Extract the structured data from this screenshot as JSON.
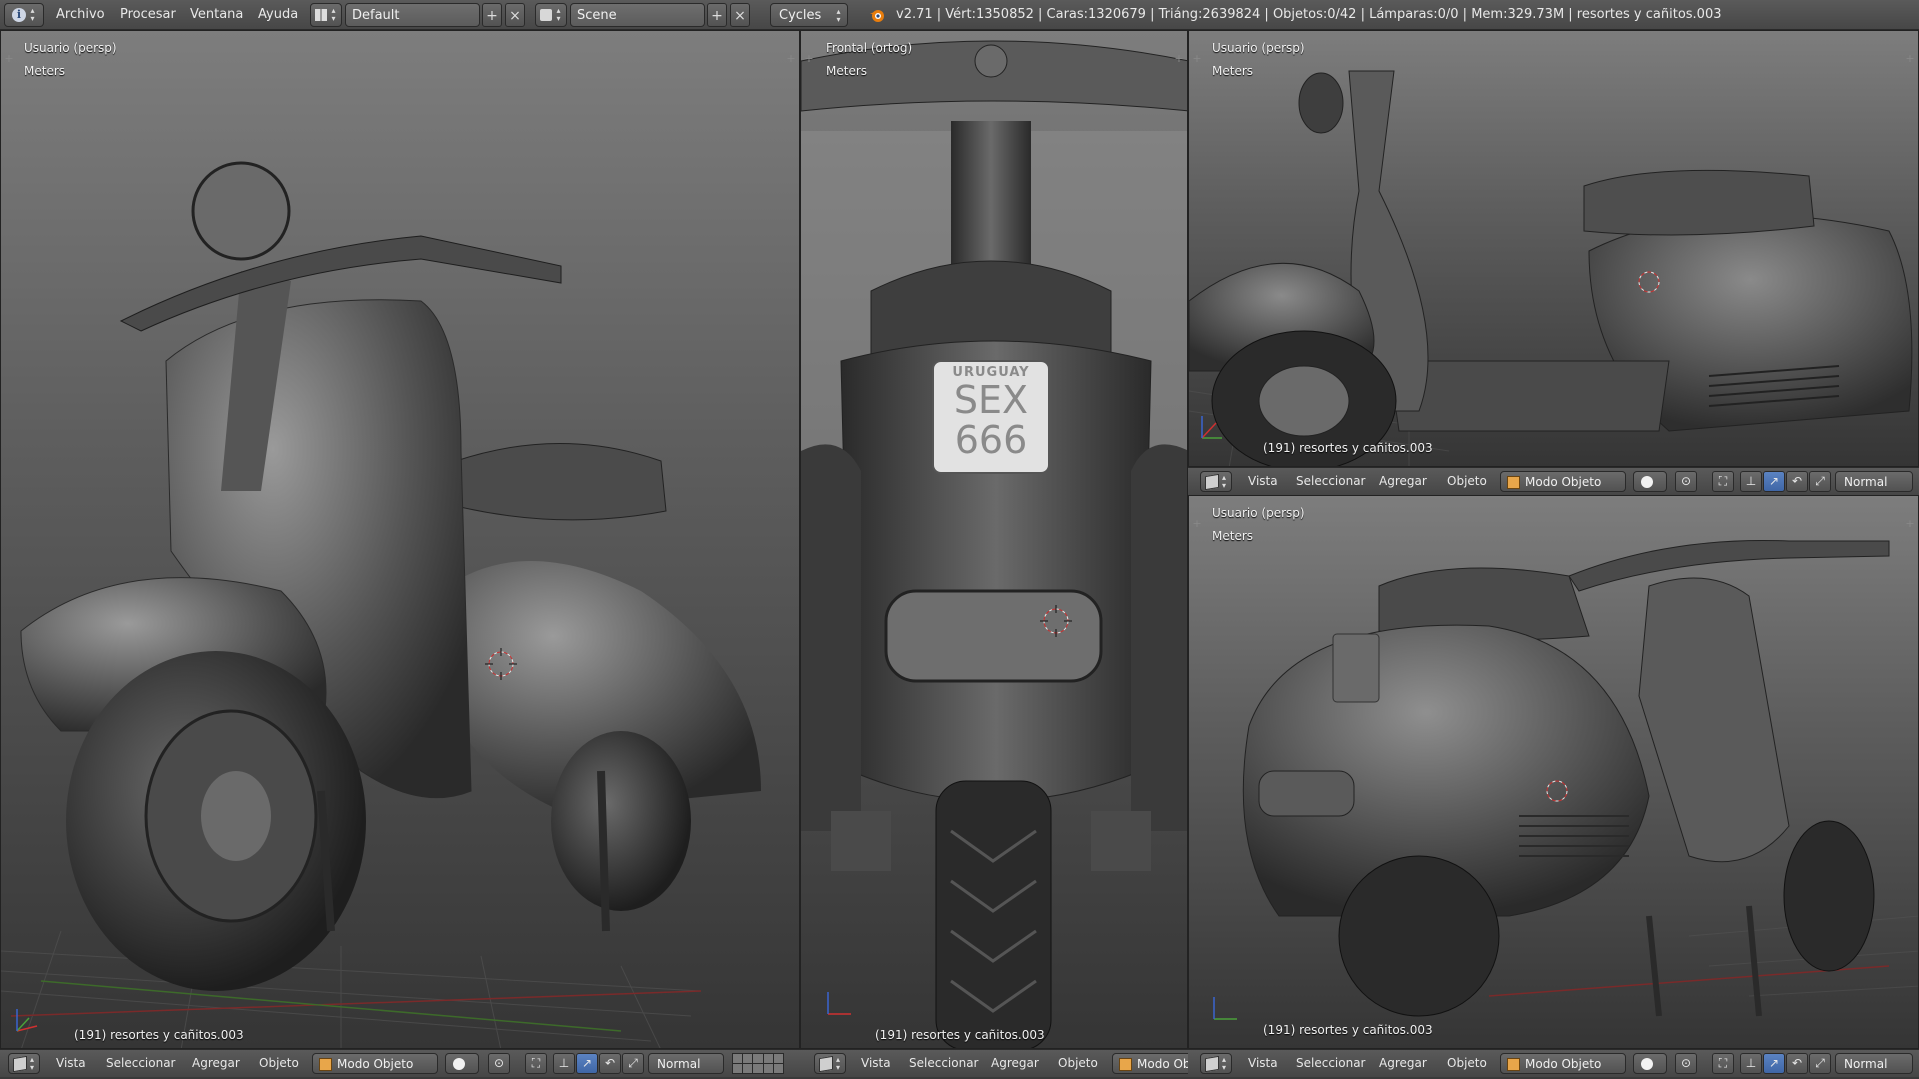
{
  "info_header": {
    "menus": [
      "Archivo",
      "Procesar",
      "Ventana",
      "Ayuda"
    ],
    "layout": "Default",
    "scene": "Scene",
    "engine": "Cycles",
    "stats": "v2.71 | Vért:1350852 | Caras:1320679 | Triáng:2639824 | Objetos:0/42 | Lámparas:0/0 | Mem:329.73M | resortes y cañitos.003"
  },
  "viewports": {
    "left": {
      "label": "Usuario (persp)",
      "units": "Meters",
      "object": "(191) resortes y cañitos.003"
    },
    "middle": {
      "label": "Frontal (ortog)",
      "units": "Meters",
      "object": "(191) resortes y cañitos.003"
    },
    "top_right": {
      "label": "Usuario (persp)",
      "units": "Meters",
      "object": "(191) resortes y cañitos.003"
    },
    "bottom_right": {
      "label": "Usuario (persp)",
      "units": "Meters",
      "object": "(191) resortes y cañitos.003"
    }
  },
  "view_header": {
    "menus": [
      "Vista",
      "Seleccionar",
      "Agregar",
      "Objeto"
    ],
    "mode": "Modo Objeto",
    "mode_truncated": "Modo Ob",
    "orientation": "Normal"
  },
  "plate": {
    "line1": "URUGUAY",
    "line2": "SEX",
    "line3": "666"
  },
  "icons": {
    "editor_type": "info-icon",
    "view3d_editor": "cube-icon",
    "engine_logo": "blender-logo-icon",
    "shading": "solid-sphere-icon",
    "manipulator": "manipulator-icon"
  },
  "colors": {
    "accent_active": "#4a73b5",
    "mode_cube": "#e8a64a",
    "header": "#4e4e4e"
  }
}
